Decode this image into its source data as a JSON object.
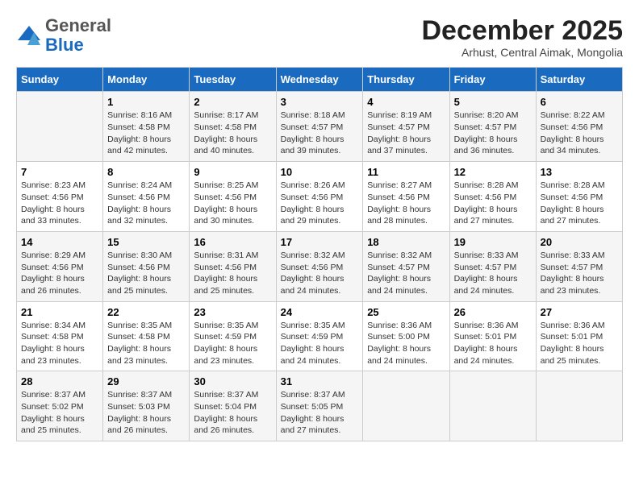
{
  "header": {
    "logo_general": "General",
    "logo_blue": "Blue",
    "month_title": "December 2025",
    "subtitle": "Arhust, Central Aimak, Mongolia"
  },
  "days_of_week": [
    "Sunday",
    "Monday",
    "Tuesday",
    "Wednesday",
    "Thursday",
    "Friday",
    "Saturday"
  ],
  "weeks": [
    [
      {
        "day": "",
        "info": ""
      },
      {
        "day": "1",
        "info": "Sunrise: 8:16 AM\nSunset: 4:58 PM\nDaylight: 8 hours\nand 42 minutes."
      },
      {
        "day": "2",
        "info": "Sunrise: 8:17 AM\nSunset: 4:58 PM\nDaylight: 8 hours\nand 40 minutes."
      },
      {
        "day": "3",
        "info": "Sunrise: 8:18 AM\nSunset: 4:57 PM\nDaylight: 8 hours\nand 39 minutes."
      },
      {
        "day": "4",
        "info": "Sunrise: 8:19 AM\nSunset: 4:57 PM\nDaylight: 8 hours\nand 37 minutes."
      },
      {
        "day": "5",
        "info": "Sunrise: 8:20 AM\nSunset: 4:57 PM\nDaylight: 8 hours\nand 36 minutes."
      },
      {
        "day": "6",
        "info": "Sunrise: 8:22 AM\nSunset: 4:56 PM\nDaylight: 8 hours\nand 34 minutes."
      }
    ],
    [
      {
        "day": "7",
        "info": "Sunrise: 8:23 AM\nSunset: 4:56 PM\nDaylight: 8 hours\nand 33 minutes."
      },
      {
        "day": "8",
        "info": "Sunrise: 8:24 AM\nSunset: 4:56 PM\nDaylight: 8 hours\nand 32 minutes."
      },
      {
        "day": "9",
        "info": "Sunrise: 8:25 AM\nSunset: 4:56 PM\nDaylight: 8 hours\nand 30 minutes."
      },
      {
        "day": "10",
        "info": "Sunrise: 8:26 AM\nSunset: 4:56 PM\nDaylight: 8 hours\nand 29 minutes."
      },
      {
        "day": "11",
        "info": "Sunrise: 8:27 AM\nSunset: 4:56 PM\nDaylight: 8 hours\nand 28 minutes."
      },
      {
        "day": "12",
        "info": "Sunrise: 8:28 AM\nSunset: 4:56 PM\nDaylight: 8 hours\nand 27 minutes."
      },
      {
        "day": "13",
        "info": "Sunrise: 8:28 AM\nSunset: 4:56 PM\nDaylight: 8 hours\nand 27 minutes."
      }
    ],
    [
      {
        "day": "14",
        "info": "Sunrise: 8:29 AM\nSunset: 4:56 PM\nDaylight: 8 hours\nand 26 minutes."
      },
      {
        "day": "15",
        "info": "Sunrise: 8:30 AM\nSunset: 4:56 PM\nDaylight: 8 hours\nand 25 minutes."
      },
      {
        "day": "16",
        "info": "Sunrise: 8:31 AM\nSunset: 4:56 PM\nDaylight: 8 hours\nand 25 minutes."
      },
      {
        "day": "17",
        "info": "Sunrise: 8:32 AM\nSunset: 4:56 PM\nDaylight: 8 hours\nand 24 minutes."
      },
      {
        "day": "18",
        "info": "Sunrise: 8:32 AM\nSunset: 4:57 PM\nDaylight: 8 hours\nand 24 minutes."
      },
      {
        "day": "19",
        "info": "Sunrise: 8:33 AM\nSunset: 4:57 PM\nDaylight: 8 hours\nand 24 minutes."
      },
      {
        "day": "20",
        "info": "Sunrise: 8:33 AM\nSunset: 4:57 PM\nDaylight: 8 hours\nand 23 minutes."
      }
    ],
    [
      {
        "day": "21",
        "info": "Sunrise: 8:34 AM\nSunset: 4:58 PM\nDaylight: 8 hours\nand 23 minutes."
      },
      {
        "day": "22",
        "info": "Sunrise: 8:35 AM\nSunset: 4:58 PM\nDaylight: 8 hours\nand 23 minutes."
      },
      {
        "day": "23",
        "info": "Sunrise: 8:35 AM\nSunset: 4:59 PM\nDaylight: 8 hours\nand 23 minutes."
      },
      {
        "day": "24",
        "info": "Sunrise: 8:35 AM\nSunset: 4:59 PM\nDaylight: 8 hours\nand 24 minutes."
      },
      {
        "day": "25",
        "info": "Sunrise: 8:36 AM\nSunset: 5:00 PM\nDaylight: 8 hours\nand 24 minutes."
      },
      {
        "day": "26",
        "info": "Sunrise: 8:36 AM\nSunset: 5:01 PM\nDaylight: 8 hours\nand 24 minutes."
      },
      {
        "day": "27",
        "info": "Sunrise: 8:36 AM\nSunset: 5:01 PM\nDaylight: 8 hours\nand 25 minutes."
      }
    ],
    [
      {
        "day": "28",
        "info": "Sunrise: 8:37 AM\nSunset: 5:02 PM\nDaylight: 8 hours\nand 25 minutes."
      },
      {
        "day": "29",
        "info": "Sunrise: 8:37 AM\nSunset: 5:03 PM\nDaylight: 8 hours\nand 26 minutes."
      },
      {
        "day": "30",
        "info": "Sunrise: 8:37 AM\nSunset: 5:04 PM\nDaylight: 8 hours\nand 26 minutes."
      },
      {
        "day": "31",
        "info": "Sunrise: 8:37 AM\nSunset: 5:05 PM\nDaylight: 8 hours\nand 27 minutes."
      },
      {
        "day": "",
        "info": ""
      },
      {
        "day": "",
        "info": ""
      },
      {
        "day": "",
        "info": ""
      }
    ]
  ]
}
